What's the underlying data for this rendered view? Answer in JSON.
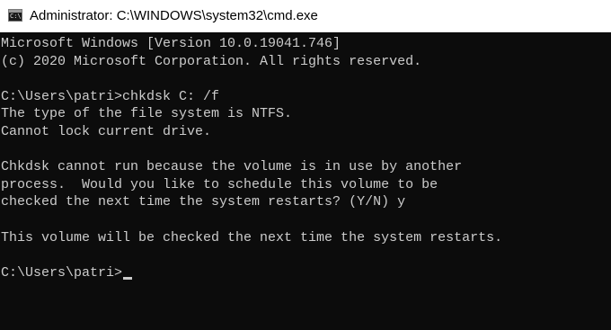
{
  "window": {
    "title": "Administrator: C:\\WINDOWS\\system32\\cmd.exe",
    "icon": "cmd-icon",
    "icon_glyph": "C:\\"
  },
  "console": {
    "lines": [
      "Microsoft Windows [Version 10.0.19041.746]",
      "(c) 2020 Microsoft Corporation. All rights reserved.",
      "",
      "C:\\Users\\patri>chkdsk C: /f",
      "The type of the file system is NTFS.",
      "Cannot lock current drive.",
      "",
      "Chkdsk cannot run because the volume is in use by another",
      "process.  Would you like to schedule this volume to be",
      "checked the next time the system restarts? (Y/N) y",
      "",
      "This volume will be checked the next time the system restarts.",
      "",
      "C:\\Users\\patri>"
    ]
  },
  "colors": {
    "console_background": "#0c0c0c",
    "console_text": "#cccccc",
    "titlebar_background": "#ffffff"
  }
}
